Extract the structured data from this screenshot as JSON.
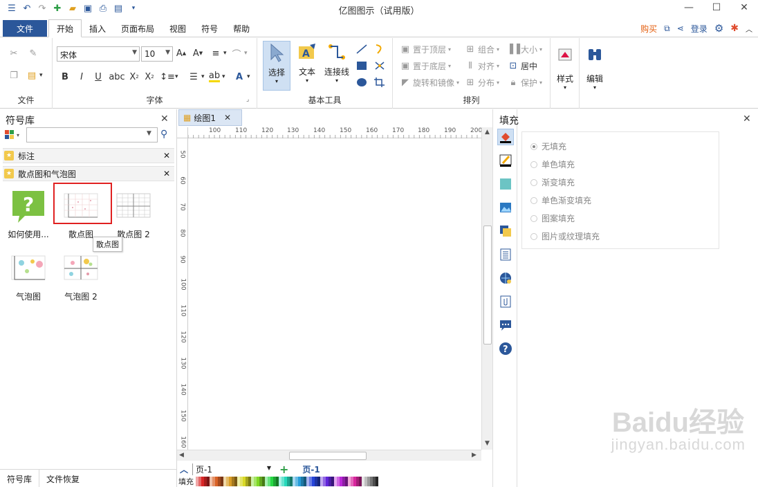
{
  "app": {
    "title": "亿图图示（试用版）"
  },
  "menu": {
    "file": "文件",
    "tabs": [
      "开始",
      "插入",
      "页面布局",
      "视图",
      "符号",
      "帮助"
    ],
    "buy": "购买",
    "login": "登录"
  },
  "ribbon": {
    "file_group": {
      "label": "文件"
    },
    "font_group": {
      "label": "字体",
      "font_name": "宋体",
      "font_size": "10"
    },
    "tools_group": {
      "label": "基本工具",
      "select": "选择",
      "text": "文本",
      "connector": "连接线"
    },
    "arrange_group": {
      "label": "排列",
      "bring_front": "置于顶层",
      "send_back": "置于底层",
      "rotate": "旋转和镜像",
      "group": "组合",
      "align": "对齐",
      "distribute": "分布",
      "size": "大小",
      "center": "居中",
      "protect": "保护"
    },
    "style": "样式",
    "edit": "编辑"
  },
  "library": {
    "title": "符号库",
    "search_placeholder": "",
    "sections": [
      "标注",
      "散点图和气泡图"
    ],
    "shapes": [
      "如何使用...",
      "散点图",
      "散点图 2",
      "气泡图",
      "气泡图 2"
    ],
    "tooltip": "散点图",
    "bottom_tabs": [
      "符号库",
      "文件恢复"
    ]
  },
  "document": {
    "tab": "绘图1",
    "hruler": [
      "100",
      "110",
      "120",
      "130",
      "140",
      "150",
      "160",
      "170",
      "180",
      "190",
      "200"
    ],
    "vruler": [
      "50",
      "60",
      "70",
      "80",
      "90",
      "100",
      "110",
      "120",
      "130",
      "140",
      "150",
      "160"
    ],
    "page_select": "页-1",
    "active_page": "页-1",
    "fill_label": "填充"
  },
  "fill": {
    "title": "填充",
    "options": [
      "无填充",
      "单色填充",
      "渐变填充",
      "单色渐变填充",
      "图案填充",
      "图片或纹理填充"
    ],
    "selected_index": 0
  },
  "watermark": {
    "main": "Baidu经验",
    "sub": "jingyan.baidu.com"
  },
  "colors": {
    "accent": "#2b579a",
    "buy": "#e45e0e",
    "highlight": "#e02020"
  }
}
